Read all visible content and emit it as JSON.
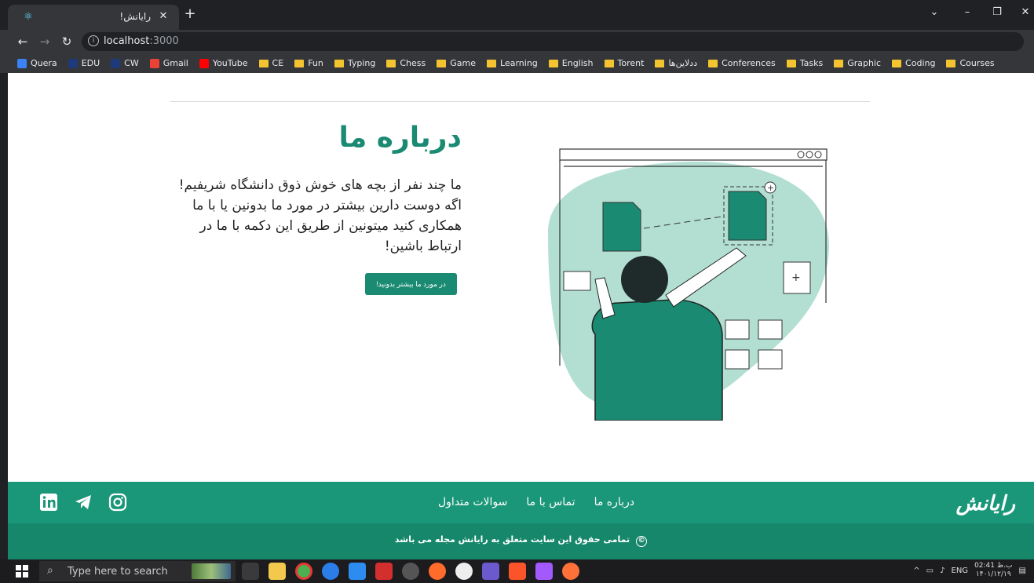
{
  "browser": {
    "tab_title": "رایانش!",
    "url_host": "localhost",
    "url_port": ":3000"
  },
  "bookmarks": [
    {
      "label": "Quera",
      "kind": "site",
      "color": "#3b82f6"
    },
    {
      "label": "EDU",
      "kind": "site",
      "color": "#1f3a7a"
    },
    {
      "label": "CW",
      "kind": "site",
      "color": "#1f3a7a"
    },
    {
      "label": "Gmail",
      "kind": "site",
      "color": "#ea4335"
    },
    {
      "label": "YouTube",
      "kind": "site",
      "color": "#ff0000"
    },
    {
      "label": "CE",
      "kind": "folder"
    },
    {
      "label": "Fun",
      "kind": "folder"
    },
    {
      "label": "Typing",
      "kind": "folder"
    },
    {
      "label": "Chess",
      "kind": "folder"
    },
    {
      "label": "Game",
      "kind": "folder"
    },
    {
      "label": "Learning",
      "kind": "folder"
    },
    {
      "label": "English",
      "kind": "folder"
    },
    {
      "label": "Torent",
      "kind": "folder"
    },
    {
      "label": "ددلاین‌ها",
      "kind": "folder"
    },
    {
      "label": "Conferences",
      "kind": "folder"
    },
    {
      "label": "Tasks",
      "kind": "folder"
    },
    {
      "label": "Graphic",
      "kind": "folder"
    },
    {
      "label": "Coding",
      "kind": "folder"
    },
    {
      "label": "Courses",
      "kind": "folder"
    }
  ],
  "about": {
    "title": "درباره ما",
    "text": "ما چند نفر از بچه های خوش ذوق دانشگاه شریفیم! اگه دوست دارین بیشتر در مورد ما بدونین یا با ما همکاری کنید میتونین از طریق این دکمه با ما در ارتباط باشین!",
    "button": "در مورد ما بیشتر بدونید!"
  },
  "footer": {
    "logo": "رایانش",
    "links": [
      "درباره ما",
      "تماس با ما",
      "سوالات متداول"
    ],
    "social": [
      "linkedin-icon",
      "telegram-icon",
      "instagram-icon"
    ],
    "copyright": "تمامی حقوق این سایت متعلق به رایانش مجله می باشد",
    "copyright_symbol": "©"
  },
  "taskbar": {
    "search_placeholder": "Type here to search",
    "lang": "ENG",
    "time": "02:41 ب.ظ",
    "date": "۱۴۰۱/۱۲/۱۹"
  },
  "colors": {
    "brand": "#1a8a72",
    "footer_top": "#1a9678",
    "footer_bottom": "#17876c"
  }
}
